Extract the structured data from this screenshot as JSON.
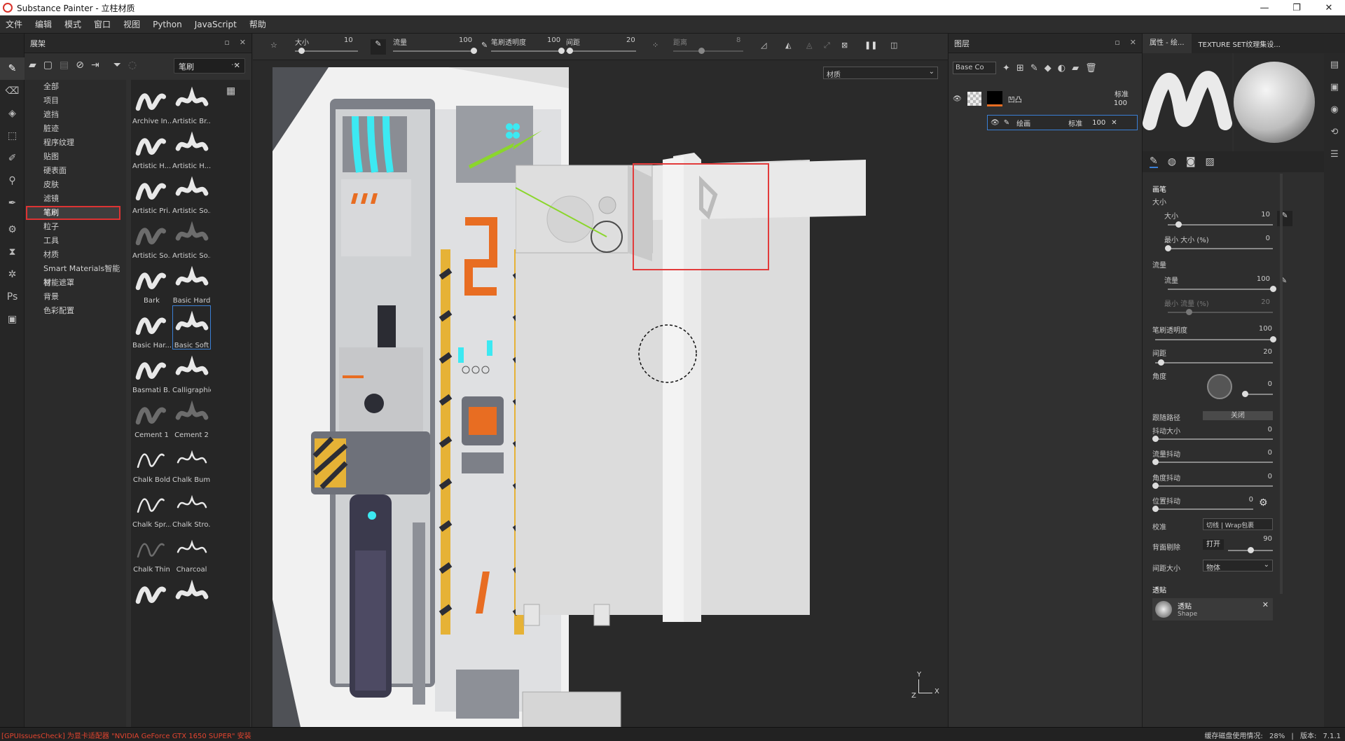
{
  "app": {
    "title": "Substance Painter - 立柱材质"
  },
  "window_controls": {
    "minimize": "—",
    "maximize": "❐",
    "close": "✕"
  },
  "menu": [
    "文件",
    "编辑",
    "模式",
    "窗口",
    "视图",
    "Python",
    "JavaScript",
    "帮助"
  ],
  "shelf": {
    "title": "展架",
    "search_value": "笔刷",
    "categories": [
      "全部",
      "项目",
      "遮挡",
      "脏迹",
      "程序纹理",
      "贴图",
      "硬表面",
      "皮肤",
      "滤镜",
      "笔刷",
      "粒子",
      "工具",
      "材质",
      "Smart Materials智能材",
      "智能遮罩",
      "背景",
      "色彩配置"
    ],
    "selected_category": "笔刷",
    "brushes": [
      "Archive In...",
      "Artistic Br...",
      "Artistic H...",
      "Artistic H...",
      "Artistic Pri...",
      "Artistic So...",
      "Artistic So...",
      "Artistic So...",
      "Bark",
      "Basic Hard",
      "Basic Har...",
      "Basic Soft",
      "Basmati B...",
      "Calligraphic",
      "Cement 1",
      "Cement 2",
      "Chalk Bold",
      "Chalk Bum...",
      "Chalk Spr...",
      "Chalk Stro...",
      "Chalk Thin",
      "Charcoal",
      "",
      ""
    ],
    "selected_brush": "Basic Soft"
  },
  "top_toolbar": {
    "size_label": "大小",
    "size_value": "10",
    "flow_label": "流量",
    "flow_value": "100",
    "opacity_label": "笔刷透明度",
    "opacity_value": "100",
    "spacing_label": "间距",
    "spacing_value": "20",
    "distance_label": "距离",
    "distance_value": "8",
    "levels": {
      "size": 0.1,
      "flow": 1.0,
      "opacity": 1.0,
      "spacing": 0.05,
      "distance": 0.4
    }
  },
  "viewport": {
    "material_mode": "材质",
    "axis_y": "Y",
    "axis_x": "X",
    "axis_z": "Z"
  },
  "layers": {
    "title": "图层",
    "channel": "Base Co",
    "layer1_name": "凹凸",
    "layer1_blend": "标准",
    "layer1_opacity": "100",
    "layer2_name": "绘画",
    "layer2_blend": "标准",
    "layer2_opacity": "100"
  },
  "properties": {
    "tab_title": "属性 - 绘...",
    "tab2_title": "TEXTURE SET纹理集设...",
    "section_brush": "画笔",
    "size_group": "大小",
    "size_label": "大小",
    "size_value": "10",
    "min_size_label": "最小 大小 (%)",
    "min_size_value": "0",
    "flow_group": "流量",
    "flow_label": "流量",
    "flow_value": "100",
    "min_flow_label": "最小 流量 (%)",
    "min_flow_value": "20",
    "opacity_label": "笔刷透明度",
    "opacity_value": "100",
    "spacing_label": "间距",
    "spacing_value": "20",
    "angle_label": "角度",
    "angle_value": "0",
    "follow_path_label": "跟随路径",
    "follow_path_value": "关闭",
    "size_jitter_label": "抖动大小",
    "size_jitter_value": "0",
    "flow_jitter_label": "流量抖动",
    "flow_jitter_value": "0",
    "angle_jitter_label": "角度抖动",
    "angle_jitter_value": "0",
    "position_jitter_label": "位置抖动",
    "position_jitter_value": "0",
    "alignment_label": "校准",
    "alignment_value": "切线 | Wrap包裹",
    "backface_label": "背面剔除",
    "backface_value": "打开",
    "backface_angle": "90",
    "spacing_size_label": "间距大小",
    "spacing_size_value": "物体",
    "stencil_section": "透贴",
    "stencil_name": "透贴",
    "stencil_type": "Shape",
    "levels": {
      "size": 0.1,
      "min_size": 0,
      "flow": 1.0,
      "min_flow": 0.2,
      "opacity": 1.0,
      "spacing": 0.05,
      "angle": 0,
      "size_jitter": 0,
      "flow_jitter": 0,
      "angle_jitter": 0,
      "position_jitter": 0,
      "backface": 0.5
    }
  },
  "status": {
    "error": "[GPUIssuesCheck] 为显卡适配器 \"NVIDIA GeForce GTX 1650 SUPER\" 安装",
    "cache_label": "缓存磁盘使用情况:",
    "cache_value": "28%",
    "version_label": "版本:",
    "version_value": "7.1.1"
  }
}
